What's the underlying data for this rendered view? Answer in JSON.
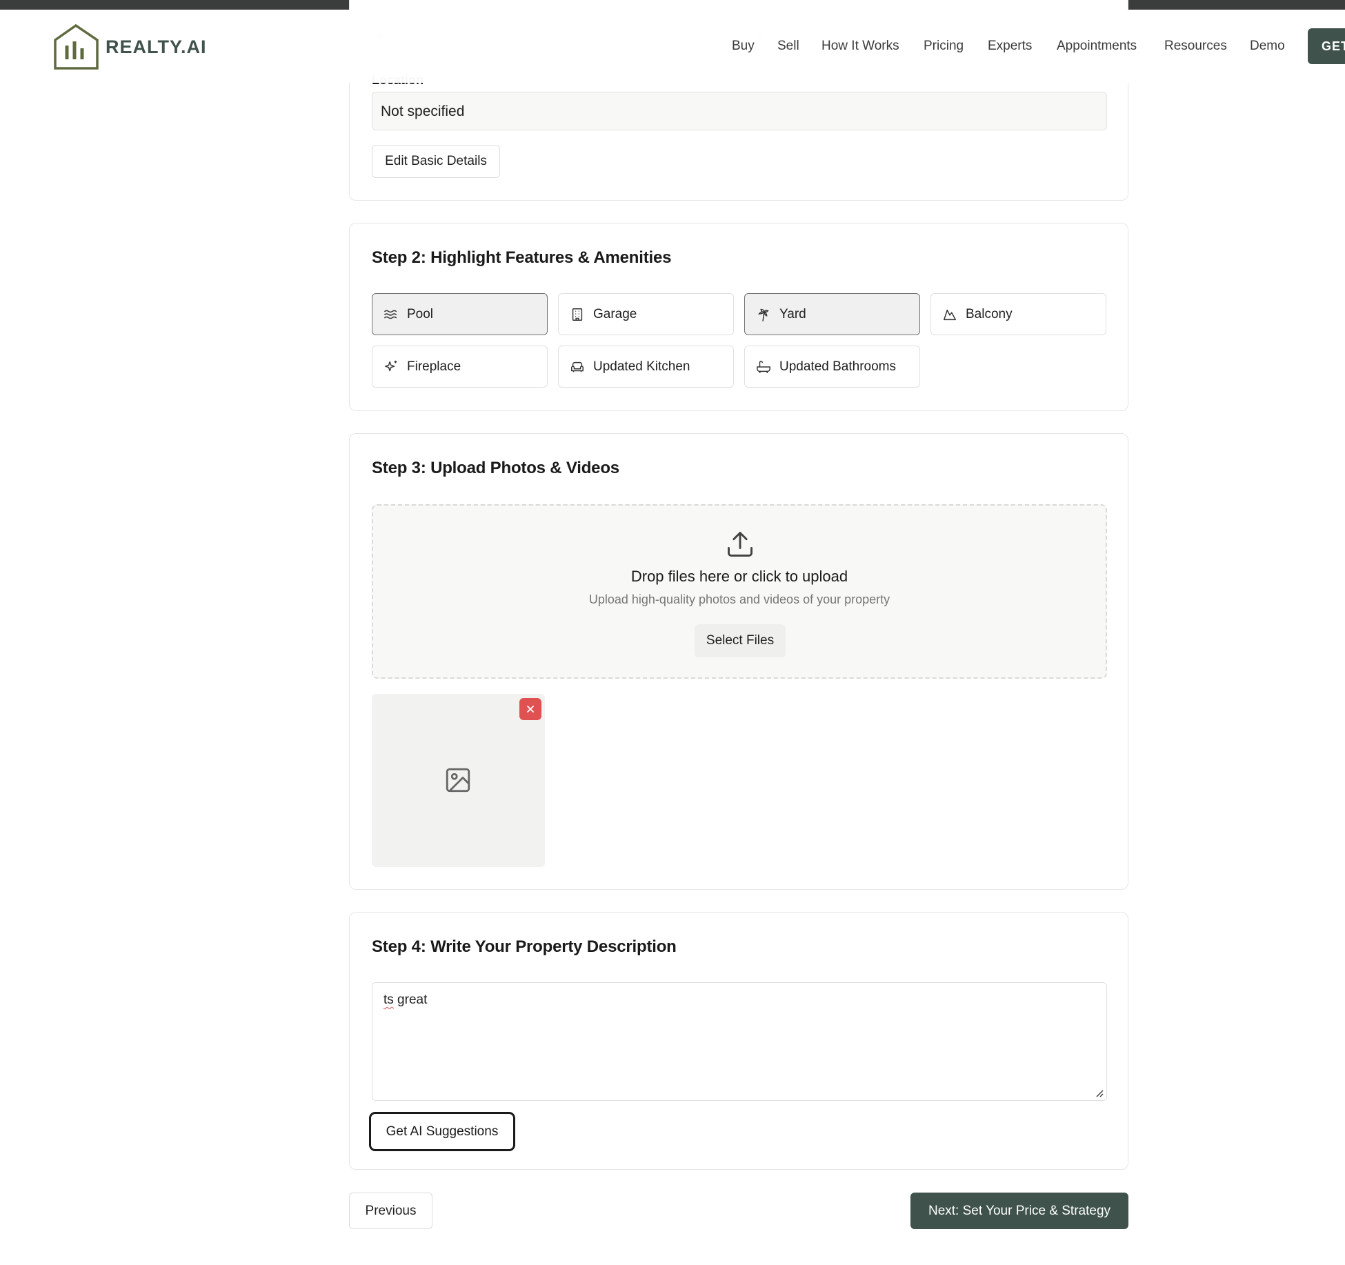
{
  "header": {
    "logo_text": "REALTY.AI",
    "nav": [
      "Buy",
      "Sell",
      "How It Works",
      "Pricing",
      "Experts",
      "Appointments",
      "Resources",
      "Demo"
    ],
    "cta_label": "GET"
  },
  "step1": {
    "location_label": "Location",
    "location_value": "Not specified",
    "edit_button": "Edit Basic Details"
  },
  "step2": {
    "title": "Step 2: Highlight Features & Amenities",
    "features": [
      {
        "label": "Pool",
        "icon": "waves-icon",
        "selected": true
      },
      {
        "label": "Garage",
        "icon": "building-icon",
        "selected": false
      },
      {
        "label": "Yard",
        "icon": "palm-tree-icon",
        "selected": true
      },
      {
        "label": "Balcony",
        "icon": "mountain-icon",
        "selected": false
      },
      {
        "label": "Fireplace",
        "icon": "sparkles-icon",
        "selected": false
      },
      {
        "label": "Updated Kitchen",
        "icon": "sofa-icon",
        "selected": false
      },
      {
        "label": "Updated Bathrooms",
        "icon": "bath-icon",
        "selected": false
      }
    ]
  },
  "step3": {
    "title": "Step 3: Upload Photos & Videos",
    "drop_title": "Drop files here or click to upload",
    "drop_sub": "Upload high-quality photos and videos of your property",
    "select_button": "Select Files"
  },
  "step4": {
    "title": "Step 4: Write Your Property Description",
    "description_misspelled": "ts",
    "description_rest": " great",
    "ai_button": "Get AI Suggestions"
  },
  "footer": {
    "previous": "Previous",
    "next": "Next: Set Your Price & Strategy"
  },
  "colors": {
    "brand": "#3f524c",
    "remove": "#e05252",
    "selected_bg": "#eff0ef"
  }
}
